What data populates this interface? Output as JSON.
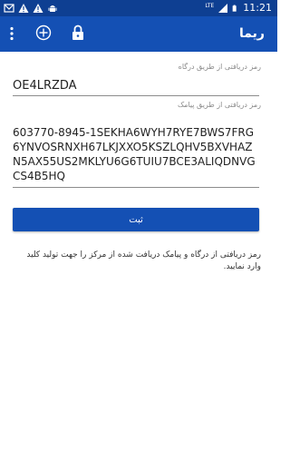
{
  "status_bar": {
    "time": "11:21",
    "left_icons": [
      "mail-icon",
      "warning-icon",
      "warning-icon",
      "android-icon"
    ],
    "right_icons": [
      "signal-icon",
      "battery-icon"
    ],
    "network_label": "LTE"
  },
  "app_bar": {
    "title": "ریما",
    "icons": [
      "more-vert-icon",
      "add-circle-icon",
      "lock-icon"
    ]
  },
  "form": {
    "gateway_code_label": "رمز دریافتی از طریق درگاه",
    "gateway_code_value": "OE4LRZDA",
    "sms_code_label": "رمز دریافتی از طریق پیامک",
    "sms_code_value": "603770-8945-1SEKHA6WYH7RYE7BWS7FRG6YNVOSRNXH67LKJXXO5KSZLQHV5BXVHAZN5AX55US2MKLYU6G6TUIU7BCE3ALIQDNVGCS4B5HQ",
    "submit_label": "ثبت"
  },
  "help_text": "رمز دریافتی از درگاه و پیامک دریافت شده از مرکز را جهت تولید کلید وارد نمایید.",
  "colors": {
    "status_bar": "#0e3f92",
    "app_bar": "#1450b4",
    "button": "#1450b4"
  }
}
